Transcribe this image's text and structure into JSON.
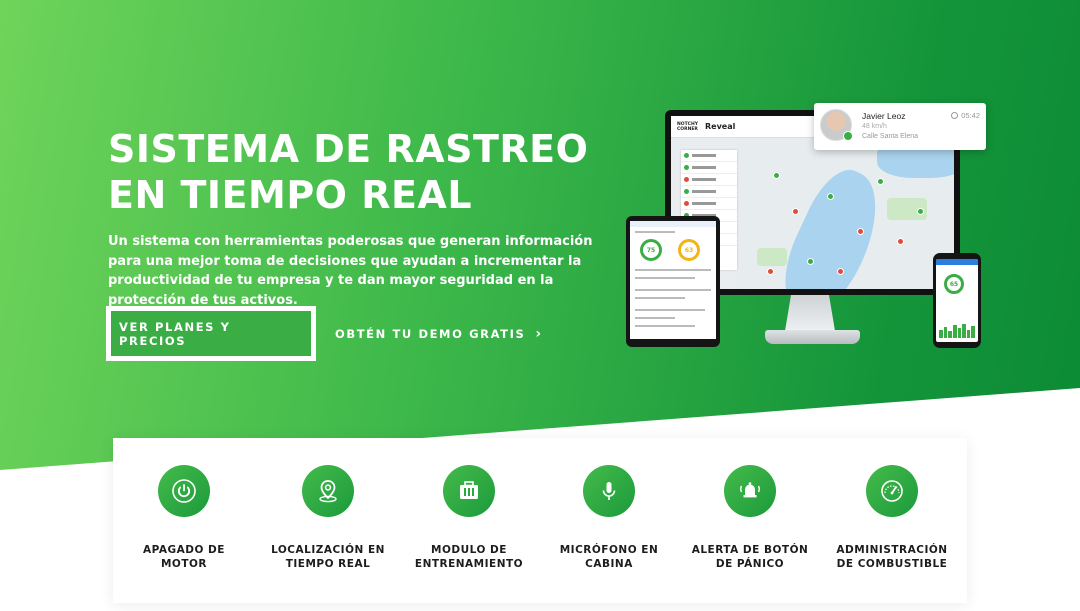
{
  "hero": {
    "title_line1": "SISTEMA DE RASTREO",
    "title_line2": "EN TIEMPO REAL",
    "description": "Un sistema con herramientas poderosas que generan información para una mejor toma de decisiones que ayudan a incrementar la productividad de tu empresa y te dan mayor seguridad en la protección de tus activos.",
    "primary_button": "VER PLANES Y PRECIOS",
    "secondary_button": "OBTÉN TU DEMO GRATIS",
    "secondary_chevron": "›"
  },
  "colors": {
    "green_light": "#6fd45a",
    "green_dark": "#0b8a35",
    "accent_green": "#3aae45"
  },
  "devices": {
    "monitor": {
      "brand": "Reveal",
      "brand_small": "NOTCHY CORNER"
    },
    "tablet": {
      "gauge_left": "75",
      "gauge_right": "63"
    },
    "phone": {
      "gauge": "65"
    },
    "driver_card": {
      "name": "Javier Leoz",
      "status": "48 km/h",
      "location": "Calle Santa Elena",
      "time": "05:42"
    }
  },
  "features": [
    {
      "icon": "power-icon",
      "label_line1": "APAGADO DE",
      "label_line2": "MOTOR"
    },
    {
      "icon": "location-pin-icon",
      "label_line1": "LOCALIZACIÓN EN",
      "label_line2": "TIEMPO REAL"
    },
    {
      "icon": "toolbox-icon",
      "label_line1": "MODULO DE",
      "label_line2": "ENTRENAMIENTO"
    },
    {
      "icon": "microphone-icon",
      "label_line1": "MICRÓFONO EN",
      "label_line2": "CABINA"
    },
    {
      "icon": "alarm-bell-icon",
      "label_line1": "ALERTA DE BOTÓN",
      "label_line2": "DE PÁNICO"
    },
    {
      "icon": "fuel-gauge-icon",
      "label_line1": "ADMINISTRACIÓN",
      "label_line2": "DE COMBUSTIBLE"
    }
  ]
}
